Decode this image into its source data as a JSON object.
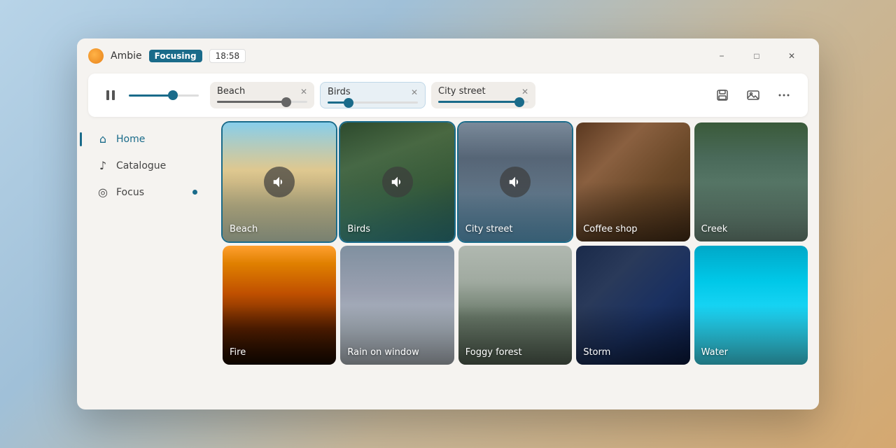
{
  "app": {
    "name": "Ambie",
    "mode_label": "Focusing",
    "timer": "18:58"
  },
  "window_controls": {
    "minimize": "−",
    "maximize": "□",
    "close": "✕"
  },
  "transport": {
    "pause_icon": "⏸",
    "master_value": 65,
    "active_sounds": [
      {
        "id": "beach",
        "name": "Beach",
        "value": 80,
        "slider_class": "beach"
      },
      {
        "id": "birds",
        "name": "Birds",
        "value": 20,
        "slider_class": "birds",
        "is_active": true
      },
      {
        "id": "city",
        "name": "City street",
        "value": 95,
        "slider_class": "city"
      }
    ],
    "save_icon": "💾",
    "image_icon": "🖼",
    "more_icon": "⋯"
  },
  "sidebar": {
    "items": [
      {
        "id": "home",
        "label": "Home",
        "icon": "⌂",
        "active": true
      },
      {
        "id": "catalogue",
        "label": "Catalogue",
        "icon": "♪",
        "active": false
      },
      {
        "id": "focus",
        "label": "Focus",
        "icon": "◎",
        "active": false,
        "dot": true
      }
    ]
  },
  "grid": {
    "sounds": [
      {
        "id": "beach",
        "label": "Beach",
        "bg": "bg-beach",
        "playing": true
      },
      {
        "id": "birds",
        "label": "Birds",
        "bg": "bg-birds",
        "playing": true
      },
      {
        "id": "city-street",
        "label": "City street",
        "bg": "bg-city-street",
        "playing": true
      },
      {
        "id": "coffee-shop",
        "label": "Coffee shop",
        "bg": "bg-coffee",
        "playing": false
      },
      {
        "id": "creek",
        "label": "Creek",
        "bg": "bg-creek",
        "playing": false
      },
      {
        "id": "fire",
        "label": "Fire",
        "bg": "bg-fire",
        "playing": false
      },
      {
        "id": "rain-window",
        "label": "Rain on window",
        "bg": "bg-rain-window",
        "playing": false
      },
      {
        "id": "fog-forest",
        "label": "Foggy forest",
        "bg": "bg-fog-forest",
        "playing": false
      },
      {
        "id": "storm",
        "label": "Storm",
        "bg": "bg-storm",
        "playing": false
      },
      {
        "id": "water",
        "label": "Water",
        "bg": "bg-water",
        "playing": false
      }
    ]
  }
}
